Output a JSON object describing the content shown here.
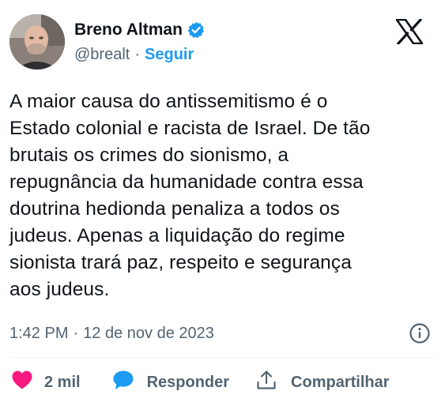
{
  "author": {
    "display_name": "Breno Altman",
    "handle": "@brealt",
    "separator": "·",
    "follow_label": "Seguir",
    "verified": true,
    "avatar_icon": "profile-photo"
  },
  "platform": {
    "logo_icon": "x-logo-icon"
  },
  "tweet": {
    "text": "A maior causa do antissemitismo é o\nEstado colonial e racista de Israel. De tão\nbrutais os crimes do sionismo, a\nrepugnância da humanidade contra essa\ndoutrina hedionda penaliza a todos os\njudeus. Apenas a liquidação do regime\nsionista trará paz, respeito e segurança\naos judeus."
  },
  "meta": {
    "time": "1:42 PM",
    "separator": "·",
    "date": "12 de nov de 2023",
    "info_icon": "info-icon"
  },
  "actions": {
    "like_count": "2 mil",
    "reply_label": "Responder",
    "share_label": "Compartilhar"
  },
  "colors": {
    "accent": "#1d9bf0",
    "like": "#f91880",
    "text": "#0f1419",
    "muted": "#536471"
  }
}
